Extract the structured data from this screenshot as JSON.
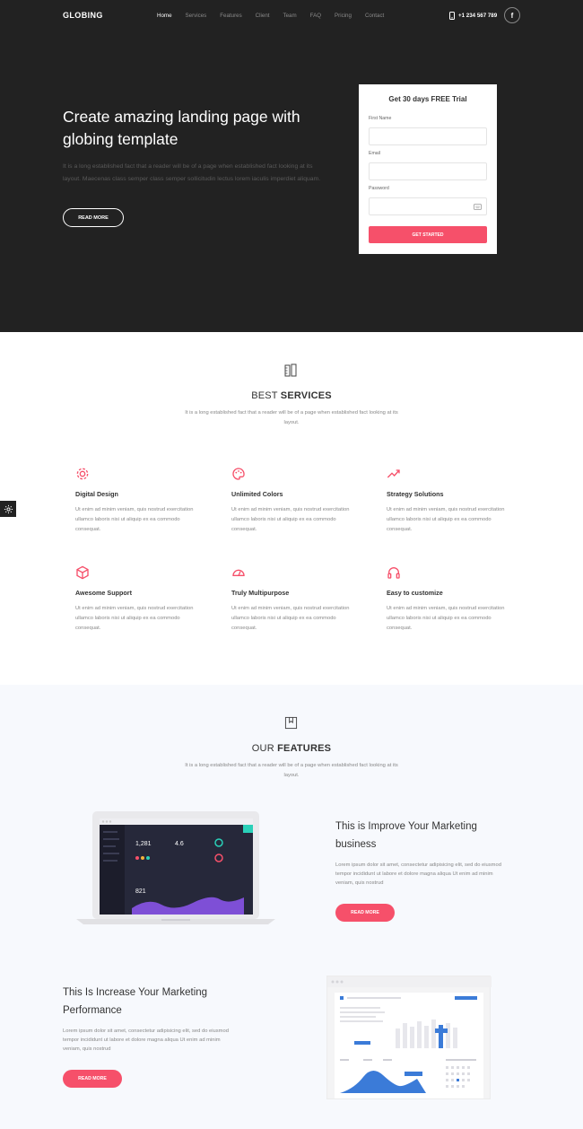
{
  "header": {
    "brand": "GLOBING",
    "nav": [
      "Home",
      "Services",
      "Features",
      "Client",
      "Team",
      "FAQ",
      "Pricing",
      "Contact"
    ],
    "active_nav": "Home",
    "phone": "+1 234 567 789",
    "social": "f"
  },
  "hero": {
    "title": "Create amazing landing page with globing template",
    "text": "It is a long established fact that a reader will be of a page when established fact looking at its layout. Maecenas class semper class semper sollicitudin lectus lorem iaculis imperdiet aliquam.",
    "button": "READ MORE"
  },
  "trial_form": {
    "title": "Get 30 days FREE Trial",
    "first_name_label": "First Name",
    "email_label": "Email",
    "password_label": "Password",
    "submit": "GET STARTED"
  },
  "services": {
    "title_light": "BEST ",
    "title_bold": "SERVICES",
    "description": "It is a long established fact that a reader will be of a page when established fact looking at its layout.",
    "items": [
      {
        "icon": "gear-icon",
        "title": "Digital Design",
        "text": "Ut enim ad minim veniam, quis nostrud exercitation ullamco laboris nisi ut aliquip ex ea commodo consequat."
      },
      {
        "icon": "palette-icon",
        "title": "Unlimited Colors",
        "text": "Ut enim ad minim veniam, quis nostrud exercitation ullamco laboris nisi ut aliquip ex ea commodo consequat."
      },
      {
        "icon": "trend-icon",
        "title": "Strategy Solutions",
        "text": "Ut enim ad minim veniam, quis nostrud exercitation ullamco laboris nisi ut aliquip ex ea commodo consequat."
      },
      {
        "icon": "box-icon",
        "title": "Awesome Support",
        "text": "Ut enim ad minim veniam, quis nostrud exercitation ullamco laboris nisi ut aliquip ex ea commodo consequat."
      },
      {
        "icon": "gauge-icon",
        "title": "Truly Multipurpose",
        "text": "Ut enim ad minim veniam, quis nostrud exercitation ullamco laboris nisi ut aliquip ex ea commodo consequat."
      },
      {
        "icon": "headphones-icon",
        "title": "Easy to customize",
        "text": "Ut enim ad minim veniam, quis nostrud exercitation ullamco laboris nisi ut aliquip ex ea commodo consequat."
      }
    ]
  },
  "features": {
    "title_light": "OUR ",
    "title_bold": "FEATURES",
    "description": "It is a long established fact that a reader will be of a page when established fact looking at its layout.",
    "items": [
      {
        "title": "This is Improve Your Marketing business",
        "text": "Lorem ipsum dolor sit amet, consectetur adipisicing elit, sed do eiusmod tempor incididunt ut labore et dolore magna aliqua Ut enim ad minim veniam, quis nostrud",
        "button": "READ MORE"
      },
      {
        "title": "This Is Increase Your Marketing Performance",
        "text": "Lorem ipsum dolor sit amet, consectetur adipisicing elit, sed do eiusmod tempor incididunt ut labore et dolore magna aliqua Ut enim ad minim veniam, quis nostrud",
        "button": "READ MORE"
      }
    ],
    "laptop_stats": [
      "1,281",
      "4.6",
      "821"
    ]
  },
  "colors": {
    "accent": "#f6506a",
    "dark": "#222222",
    "light_bg": "#f7f9fd"
  }
}
